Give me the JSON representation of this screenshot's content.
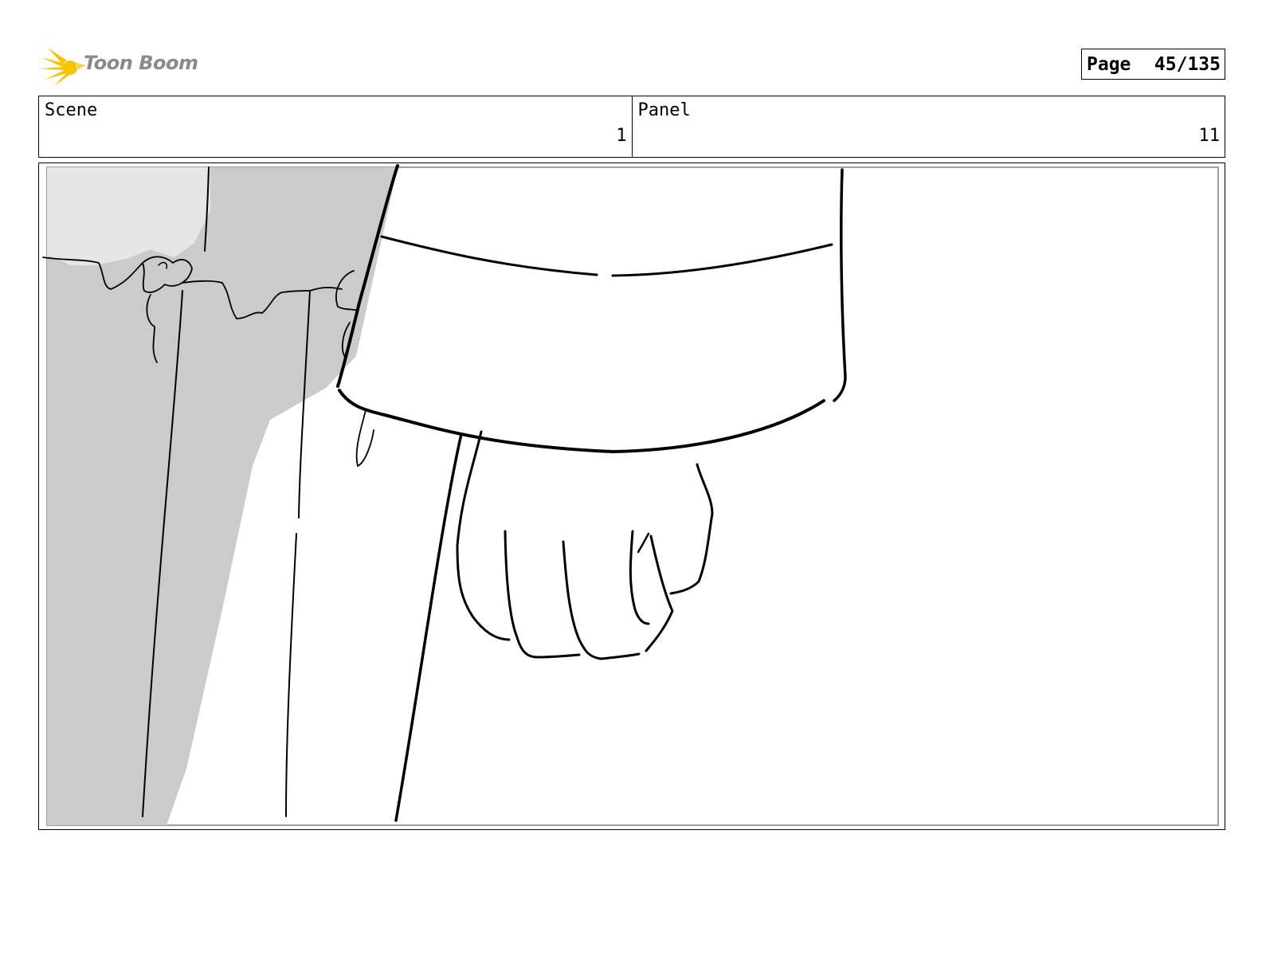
{
  "header": {
    "logo_text": "Toon Boom",
    "page_label": "Page",
    "page_number": "45/135"
  },
  "scene": {
    "label": "Scene",
    "value": "1"
  },
  "panel": {
    "label": "Panel",
    "value": "11"
  },
  "colors": {
    "logo_star": "#f5c400",
    "logo_text": "#8a8a8a",
    "sketch_gray": "#cbcbcb",
    "sketch_light": "#e6e6e6",
    "line": "#000000"
  }
}
